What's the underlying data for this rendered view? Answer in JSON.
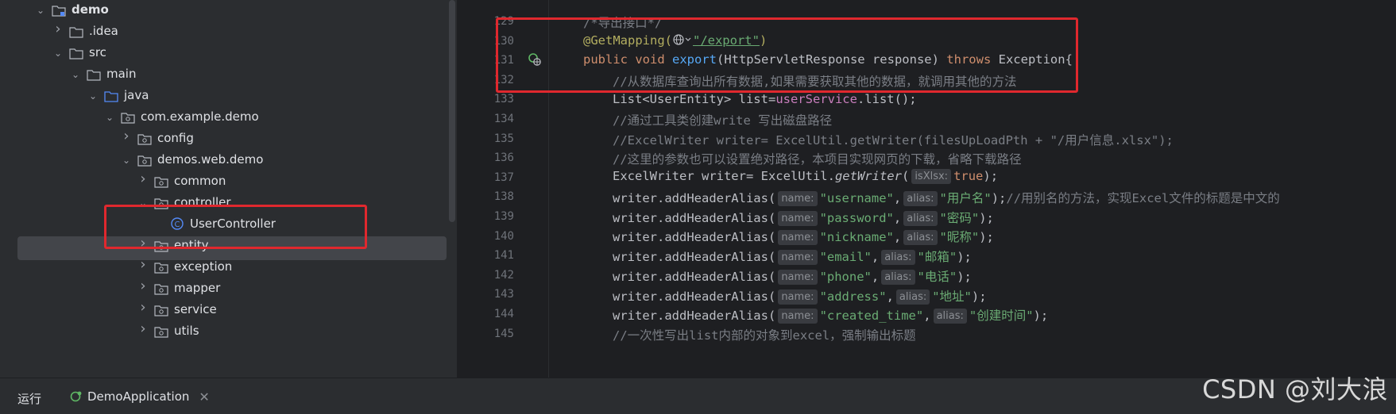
{
  "tree": {
    "rows": [
      {
        "label": "demo",
        "arrow": "open",
        "icon": "module",
        "bold": true
      },
      {
        "label": ".idea",
        "arrow": "closed",
        "icon": "folder"
      },
      {
        "label": "src",
        "arrow": "open",
        "icon": "folder"
      },
      {
        "label": "main",
        "arrow": "open",
        "icon": "folder"
      },
      {
        "label": "java",
        "arrow": "open",
        "icon": "source-folder"
      },
      {
        "label": "com.example.demo",
        "arrow": "open",
        "icon": "package"
      },
      {
        "label": "config",
        "arrow": "closed",
        "icon": "package"
      },
      {
        "label": "demos.web.demo",
        "arrow": "open",
        "icon": "package"
      },
      {
        "label": "common",
        "arrow": "closed",
        "icon": "package"
      },
      {
        "label": "controller",
        "arrow": "open",
        "icon": "package"
      },
      {
        "label": "UserController",
        "arrow": "none",
        "icon": "class",
        "selected": true
      },
      {
        "label": "entity",
        "arrow": "closed",
        "icon": "package"
      },
      {
        "label": "exception",
        "arrow": "closed",
        "icon": "package"
      },
      {
        "label": "mapper",
        "arrow": "closed",
        "icon": "package"
      },
      {
        "label": "service",
        "arrow": "closed",
        "icon": "package"
      },
      {
        "label": "utils",
        "arrow": "closed",
        "icon": "package"
      }
    ]
  },
  "editor": {
    "line_numbers": [
      "129",
      "130",
      "131",
      "132",
      "133",
      "134",
      "135",
      "136",
      "137",
      "138",
      "139",
      "140",
      "141",
      "142",
      "143",
      "144",
      "145"
    ],
    "code": {
      "l129": "/*导出接口*/",
      "l130_annot": "@GetMapping(",
      "l130_str": "\"/export\"",
      "l130_end": ")",
      "l131_kw1": "public void ",
      "l131_fn": "export",
      "l131_mid": "(HttpServletResponse response) ",
      "l131_kw2": "throws",
      "l131_end": " Exception{",
      "l132": "//从数据库查询出所有数据,如果需要获取其他的数据，就调用其他的方法",
      "l133_a": "List<UserEntity> list=",
      "l133_fld": "userService",
      "l133_b": ".list();",
      "l134": "//通过工具类创建write 写出磁盘路径",
      "l135": "//ExcelWriter writer= ExcelUtil.getWriter(filesUpLoadPth + \"/用户信息.xlsx\");",
      "l136": "//这里的参数也可以设置绝对路径，本项目实现网页的下载，省略下载路径",
      "l137_a": "ExcelWriter writer= ExcelUtil.",
      "l137_it": "getWriter",
      "l137_b": "(",
      "l137_hint": "isXlsx:",
      "l137_kw": "true",
      "l137_c": ");",
      "alias_call": "writer.addHeaderAlias(",
      "hint_name": "name:",
      "hint_alias": "alias:",
      "aliases": [
        {
          "name": "\"username\"",
          "alias": "\"用户名\"",
          "tail": ");",
          "comment": "//用别名的方法，实现Excel文件的标题是中文的"
        },
        {
          "name": "\"password\"",
          "alias": "\"密码\"",
          "tail": ");",
          "comment": ""
        },
        {
          "name": "\"nickname\"",
          "alias": "\"昵称\"",
          "tail": ");",
          "comment": ""
        },
        {
          "name": "\"email\"",
          "alias": "\"邮箱\"",
          "tail": ");",
          "comment": ""
        },
        {
          "name": "\"phone\"",
          "alias": "\"电话\"",
          "tail": ");",
          "comment": ""
        },
        {
          "name": "\"address\"",
          "alias": "\"地址\"",
          "tail": ");",
          "comment": ""
        },
        {
          "name": "\"created_time\"",
          "alias": "\"创建时间\"",
          "tail": ");",
          "comment": ""
        }
      ],
      "l145": "//一次性写出list内部的对象到excel，强制输出标题"
    }
  },
  "bottombar": {
    "run_tab": "运行",
    "app_tab": "DemoApplication"
  },
  "watermark": "CSDN @刘大浪",
  "colors": {
    "annotation_red": "#e0282e",
    "keyword": "#cf8e6d",
    "string": "#6aab73",
    "function": "#56a8f5",
    "comment": "#7a7e85"
  }
}
